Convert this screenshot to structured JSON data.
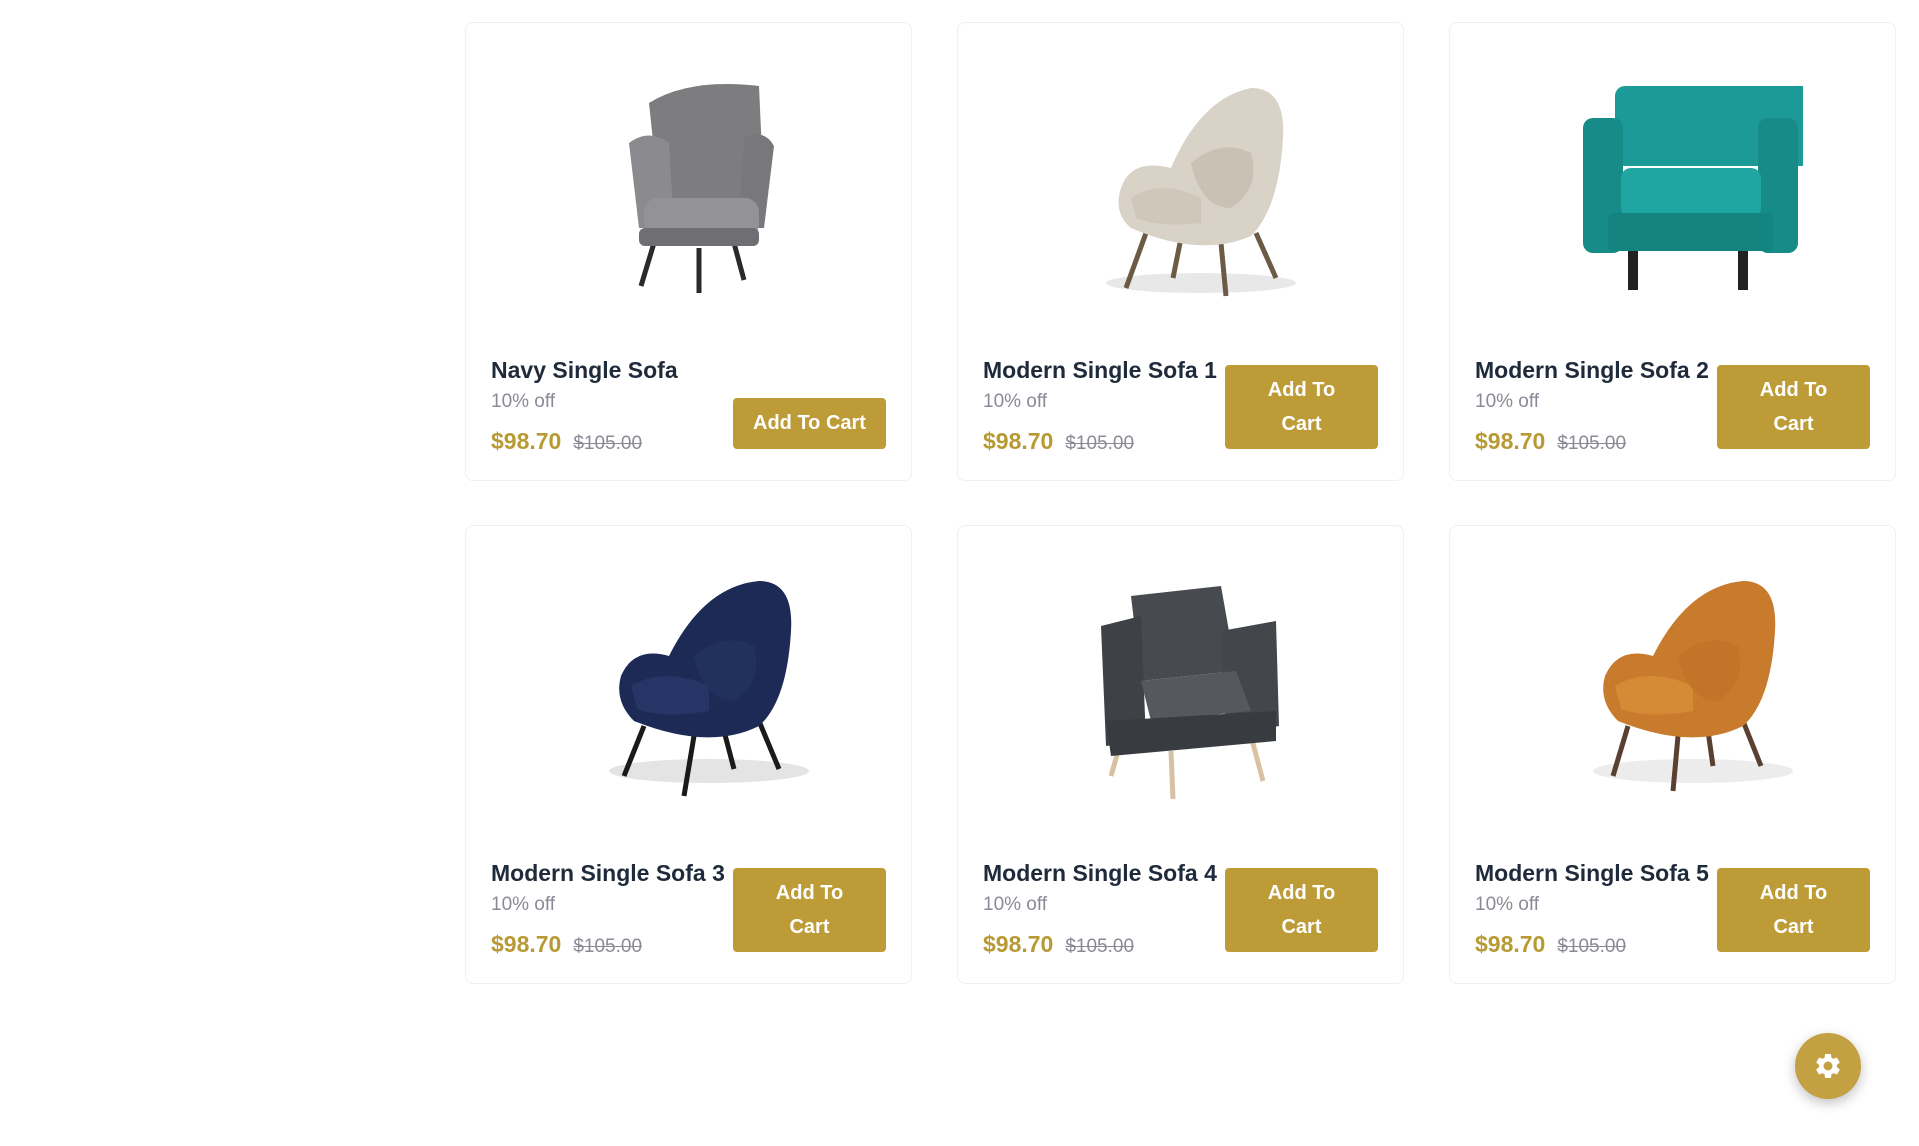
{
  "products": [
    {
      "name": "Navy Single Sofa",
      "discount": "10% off",
      "price": "$98.70",
      "old_price": "$105.00",
      "button": "Add To Cart",
      "image": "grey-armchair"
    },
    {
      "name": "Modern Single Sofa 1",
      "discount": "10% off",
      "price": "$98.70",
      "old_price": "$105.00",
      "button": "Add To Cart",
      "image": "beige-lounge-chair"
    },
    {
      "name": "Modern Single Sofa 2",
      "discount": "10% off",
      "price": "$98.70",
      "old_price": "$105.00",
      "button": "Add To Cart",
      "image": "teal-armchair"
    },
    {
      "name": "Modern Single Sofa 3",
      "discount": "10% off",
      "price": "$98.70",
      "old_price": "$105.00",
      "button": "Add To Cart",
      "image": "navy-lounge-chair"
    },
    {
      "name": "Modern Single Sofa 4",
      "discount": "10% off",
      "price": "$98.70",
      "old_price": "$105.00",
      "button": "Add To Cart",
      "image": "dark-grey-armchair"
    },
    {
      "name": "Modern Single Sofa 5",
      "discount": "10% off",
      "price": "$98.70",
      "old_price": "$105.00",
      "button": "Add To Cart",
      "image": "orange-lounge-chair"
    }
  ],
  "colors": {
    "accent": "#bd9c38",
    "price": "#b89a34"
  },
  "fab": {
    "icon": "gear-icon"
  }
}
